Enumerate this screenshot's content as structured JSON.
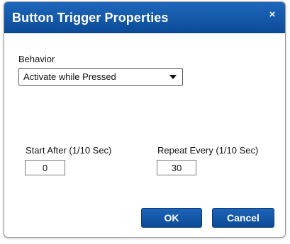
{
  "dialog": {
    "title": "Button Trigger Properties",
    "close_glyph": "×"
  },
  "behavior": {
    "label": "Behavior",
    "selected": "Activate while Pressed"
  },
  "start_after": {
    "label": "Start After (1/10 Sec)",
    "value": "0"
  },
  "repeat_every": {
    "label": "Repeat Every (1/10 Sec)",
    "value": "30"
  },
  "buttons": {
    "ok": "OK",
    "cancel": "Cancel"
  },
  "colors": {
    "titlebar": "#0b4c98",
    "button": "#0c4b96"
  },
  "icons": {
    "close": "close-icon",
    "dropdown": "chevron-down-icon"
  }
}
